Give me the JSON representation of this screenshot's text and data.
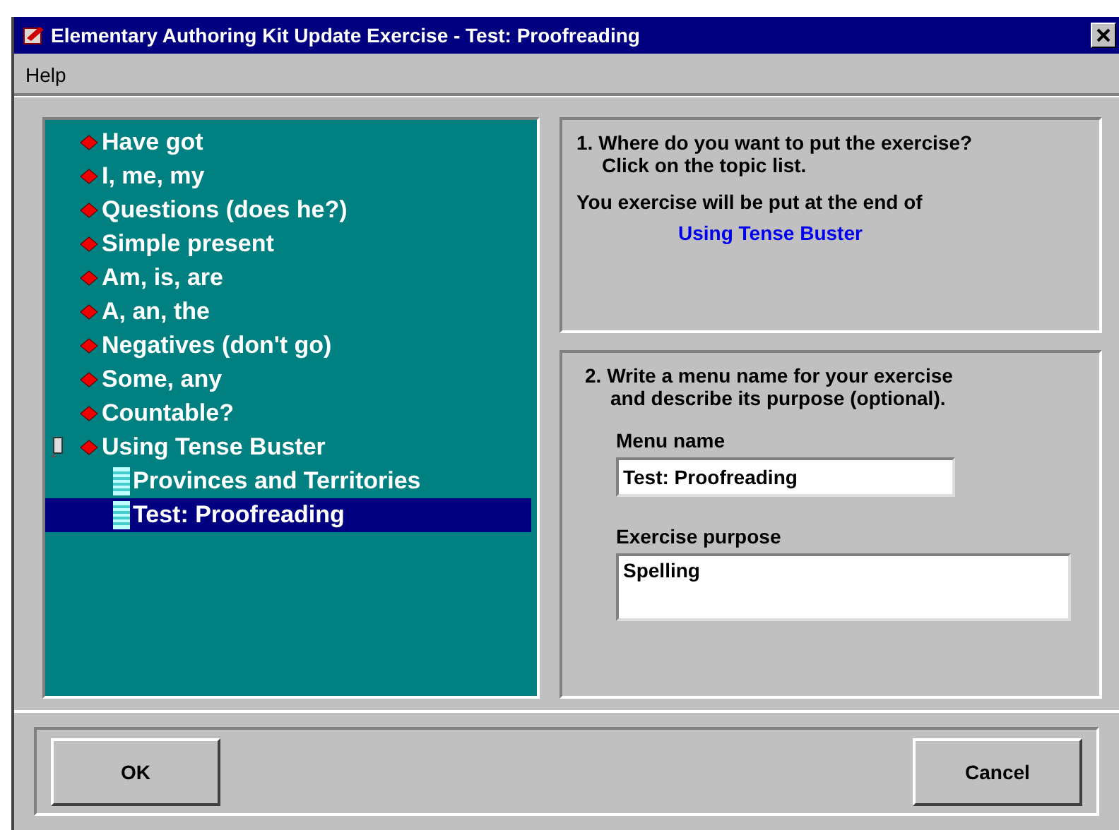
{
  "window": {
    "title": "Elementary Authoring Kit Update Exercise - Test: Proofreading"
  },
  "menu": [
    "Help"
  ],
  "topics": [
    {
      "label": "Have got",
      "kind": "topic",
      "current": false,
      "selected": false
    },
    {
      "label": "I, me, my",
      "kind": "topic",
      "current": false,
      "selected": false
    },
    {
      "label": "Questions (does he?)",
      "kind": "topic",
      "current": false,
      "selected": false
    },
    {
      "label": "Simple present",
      "kind": "topic",
      "current": false,
      "selected": false
    },
    {
      "label": "Am, is, are",
      "kind": "topic",
      "current": false,
      "selected": false
    },
    {
      "label": "A, an, the",
      "kind": "topic",
      "current": false,
      "selected": false
    },
    {
      "label": "Negatives (don't go)",
      "kind": "topic",
      "current": false,
      "selected": false
    },
    {
      "label": "Some, any",
      "kind": "topic",
      "current": false,
      "selected": false
    },
    {
      "label": "Countable?",
      "kind": "topic",
      "current": false,
      "selected": false
    },
    {
      "label": "Using Tense Buster",
      "kind": "topic",
      "current": true,
      "selected": false,
      "children": [
        {
          "label": "Provinces and Territories",
          "kind": "exercise",
          "current": false,
          "selected": false
        },
        {
          "label": "Test: Proofreading",
          "kind": "exercise",
          "current": false,
          "selected": true
        }
      ]
    }
  ],
  "step1": {
    "heading": "1. Where do you want to put the exercise?",
    "hint": "Click on the topic list.",
    "note": "You exercise will be put at the end of",
    "target": "Using Tense Buster"
  },
  "step2": {
    "heading": "2. Write a menu name for your exercise",
    "hint": "and describe its purpose (optional).",
    "menu_name": {
      "label": "Menu name",
      "value": "Test: Proofreading"
    },
    "purpose": {
      "label": "Exercise purpose",
      "value": "Spelling"
    }
  },
  "buttons": [
    "OK",
    "Cancel"
  ]
}
